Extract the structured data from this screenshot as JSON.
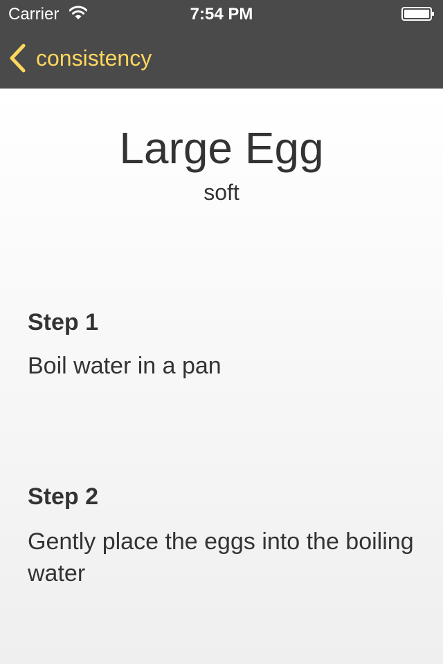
{
  "status_bar": {
    "carrier": "Carrier",
    "time": "7:54 PM",
    "wifi_icon": "wifi-icon",
    "battery_icon": "battery-icon"
  },
  "nav": {
    "back_label": "consistency",
    "back_icon": "chevron-left-icon",
    "accent_color": "#ffd75e",
    "bar_color": "#4a4a4a"
  },
  "main": {
    "title": "Large Egg",
    "subtitle": "soft",
    "steps": [
      {
        "heading": "Step 1",
        "text": "Boil water in a pan"
      },
      {
        "heading": "Step 2",
        "text": "Gently place the eggs into the boiling water"
      }
    ]
  }
}
